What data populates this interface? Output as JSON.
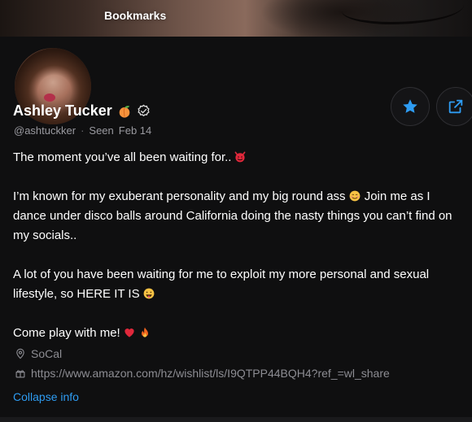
{
  "cover": {
    "title": "Bookmarks"
  },
  "profile": {
    "name": "Ashley Tucker",
    "handle": "@ashtuckker",
    "seen_label": "Seen",
    "seen_date": "Feb 14",
    "bio": {
      "line1": "The moment you’ve all been waiting for..",
      "para2_a": "I’m known for my exuberant personality and my big round ass",
      "para2_b": "Join me as I dance under disco balls around California doing the nasty things you can’t find on my socials..",
      "para3": "A lot of you have been waiting for me to exploit my more personal and sexual lifestyle, so HERE IT IS",
      "para4": "Come play with me!"
    },
    "location": "SoCal",
    "link": "https://www.amazon.com/hz/wishlist/ls/I9QTPP44BQH4?ref_=wl_share",
    "collapse_label": "Collapse info"
  },
  "icons": {
    "name_badges": [
      "peach-icon",
      "verified-icon"
    ],
    "actions": [
      "star-icon",
      "share-icon"
    ],
    "emojis": [
      "devil-emoji",
      "smile-emoji",
      "tongue-emoji",
      "heart-emoji",
      "fire-emoji"
    ]
  },
  "colors": {
    "accent": "#2e9cf2",
    "background": "#0f0f10",
    "muted_text": "#9a9aa0"
  }
}
